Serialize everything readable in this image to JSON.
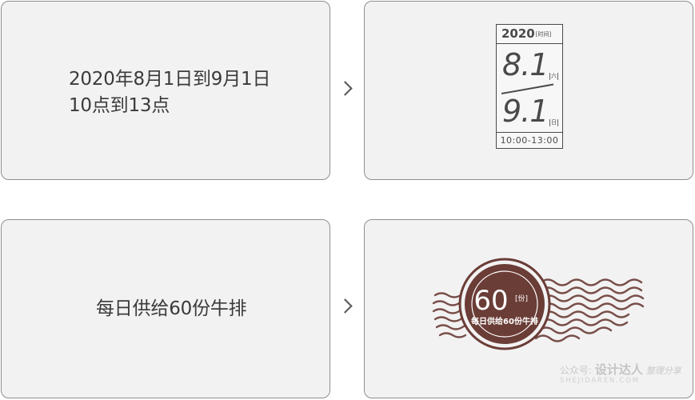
{
  "cards": {
    "top_left": {
      "line1": "2020年8月1日到9月1日",
      "line2": "10点到13点"
    },
    "top_right": {
      "year": "2020",
      "year_tag": "[时间]",
      "start_date": "8.1",
      "start_weekday": "六",
      "end_date": "9.1",
      "end_weekday": "日",
      "time_range": "10:00-13:00"
    },
    "bottom_left": {
      "text": "每日供给60份牛排"
    },
    "bottom_right": {
      "stamp_number": "60",
      "stamp_unit": "[份]",
      "stamp_caption": "每日供给60份牛排",
      "stamp_color": "#6b3d37"
    }
  },
  "arrows": [
    "chevron-right-icon",
    "chevron-right-icon"
  ],
  "watermark": {
    "prefix": "公众号:",
    "brand": "设计达人",
    "suffix": "整理分享",
    "url": "SHEJIDAREN.COM"
  }
}
